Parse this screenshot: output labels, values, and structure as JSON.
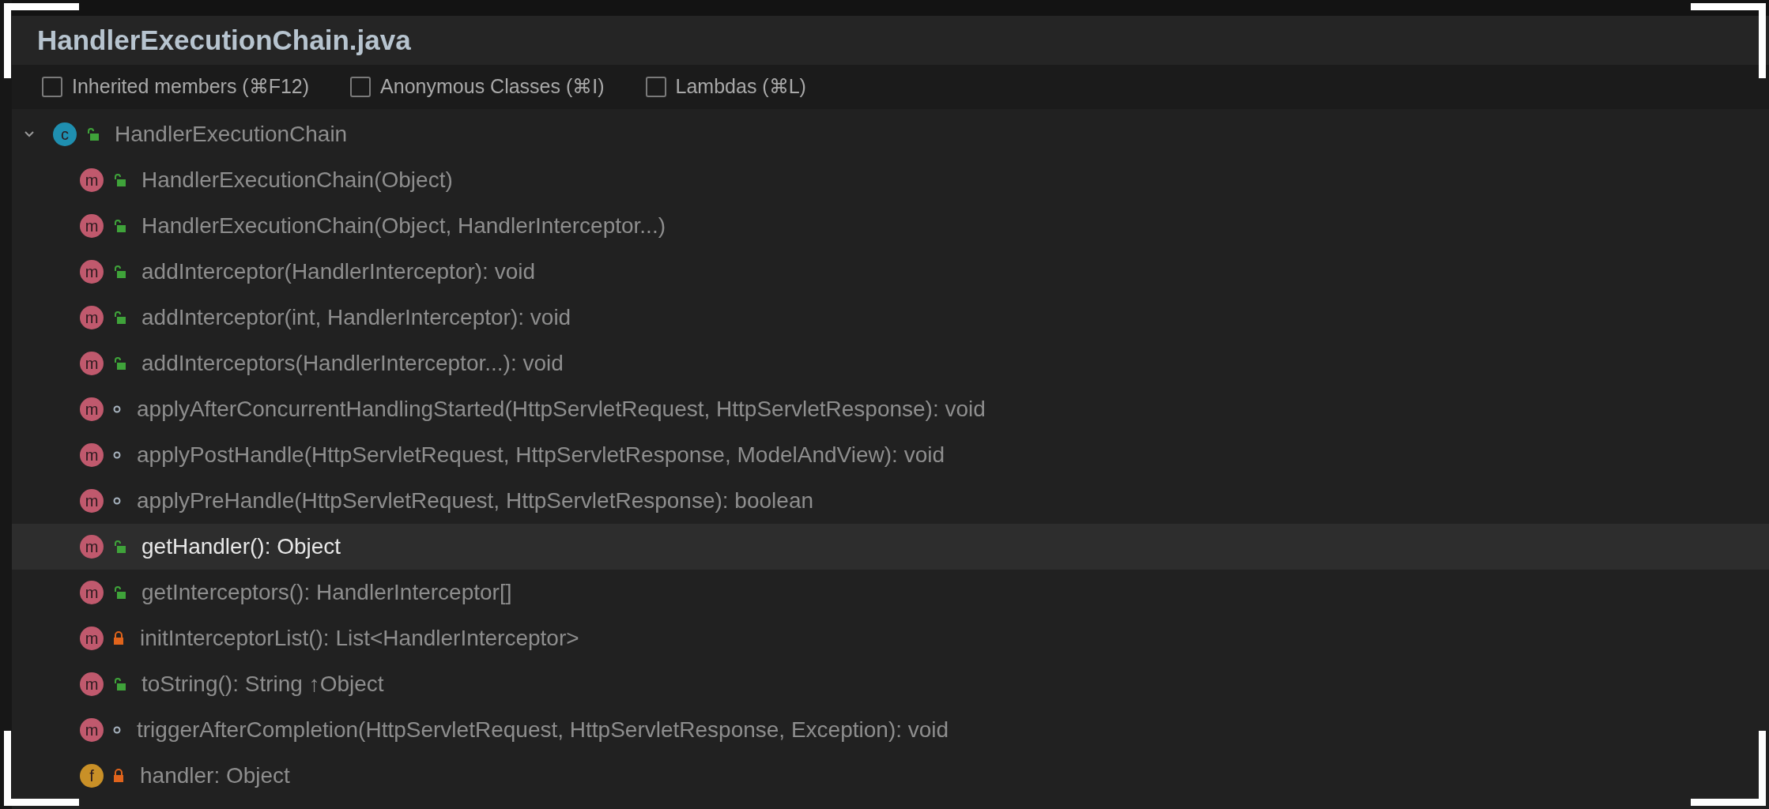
{
  "title": "HandlerExecutionChain.java",
  "filters": [
    {
      "label": "Inherited members (⌘F12)",
      "checked": false
    },
    {
      "label": "Anonymous Classes (⌘I)",
      "checked": false
    },
    {
      "label": "Lambdas (⌘L)",
      "checked": false
    }
  ],
  "tree": {
    "label": "HandlerExecutionChain",
    "kind": "class",
    "icon_letter": "c",
    "access": {
      "kind": "public"
    },
    "expanded": true,
    "selected": false,
    "children": [
      {
        "label": "HandlerExecutionChain(Object)",
        "kind": "method",
        "icon_letter": "m",
        "access": {
          "kind": "public"
        },
        "selected": false
      },
      {
        "label": "HandlerExecutionChain(Object, HandlerInterceptor...)",
        "kind": "method",
        "icon_letter": "m",
        "access": {
          "kind": "public"
        },
        "selected": false
      },
      {
        "label": "addInterceptor(HandlerInterceptor): void",
        "kind": "method",
        "icon_letter": "m",
        "access": {
          "kind": "public"
        },
        "selected": false
      },
      {
        "label": "addInterceptor(int, HandlerInterceptor): void",
        "kind": "method",
        "icon_letter": "m",
        "access": {
          "kind": "public"
        },
        "selected": false
      },
      {
        "label": "addInterceptors(HandlerInterceptor...): void",
        "kind": "method",
        "icon_letter": "m",
        "access": {
          "kind": "public"
        },
        "selected": false
      },
      {
        "label": "applyAfterConcurrentHandlingStarted(HttpServletRequest, HttpServletResponse): void",
        "kind": "method",
        "icon_letter": "m",
        "access": {
          "kind": "package"
        },
        "selected": false
      },
      {
        "label": "applyPostHandle(HttpServletRequest, HttpServletResponse, ModelAndView): void",
        "kind": "method",
        "icon_letter": "m",
        "access": {
          "kind": "package"
        },
        "selected": false
      },
      {
        "label": "applyPreHandle(HttpServletRequest, HttpServletResponse): boolean",
        "kind": "method",
        "icon_letter": "m",
        "access": {
          "kind": "package"
        },
        "selected": false
      },
      {
        "label": "getHandler(): Object",
        "kind": "method",
        "icon_letter": "m",
        "access": {
          "kind": "public"
        },
        "selected": true
      },
      {
        "label": "getInterceptors(): HandlerInterceptor[]",
        "kind": "method",
        "icon_letter": "m",
        "access": {
          "kind": "public"
        },
        "selected": false
      },
      {
        "label": "initInterceptorList(): List<HandlerInterceptor>",
        "kind": "method",
        "icon_letter": "m",
        "access": {
          "kind": "private"
        },
        "selected": false
      },
      {
        "label": "toString(): String ↑Object",
        "kind": "method",
        "icon_letter": "m",
        "access": {
          "kind": "public"
        },
        "selected": false
      },
      {
        "label": "triggerAfterCompletion(HttpServletRequest, HttpServletResponse, Exception): void",
        "kind": "method",
        "icon_letter": "m",
        "access": {
          "kind": "package"
        },
        "selected": false
      },
      {
        "label": "handler: Object",
        "kind": "field",
        "icon_letter": "f",
        "access": {
          "kind": "private"
        },
        "selected": false
      }
    ]
  }
}
